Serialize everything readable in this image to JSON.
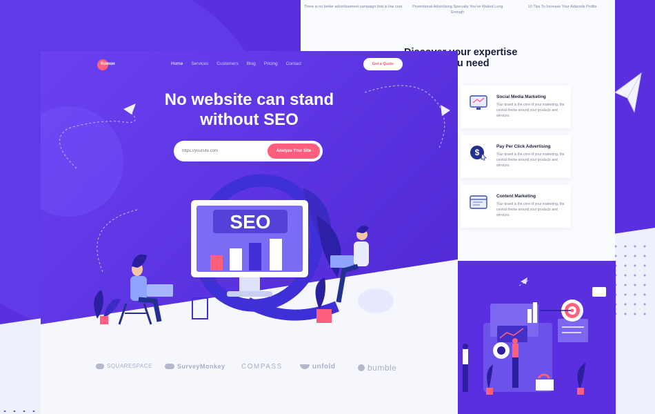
{
  "colors": {
    "brand_purple": "#5a2fe0",
    "accent_pink": "#ff5f7e",
    "light_bg": "#f6f7fd"
  },
  "nav": {
    "logo": "Romon",
    "links": [
      "Home",
      "Services",
      "Customers",
      "Blog",
      "Pricing",
      "Contact"
    ],
    "active": "Home",
    "cta": "Get a Quote"
  },
  "hero": {
    "title_line1": "No website can stand",
    "title_line2": "without SEO",
    "search_placeholder": "https://yoursite.com",
    "analyze_button": "Analyze Your Site",
    "illustration_text": "SEO"
  },
  "brands": [
    "SQUARESPACE",
    "SurveyMonkey",
    "COMPASS",
    "unfold",
    "bumble"
  ],
  "right_panel": {
    "top_texts": [
      "There is no better advertisement campaign that is low cost",
      "Promotional Advertising Specialty You've Waited Long Enough",
      "10 Tips To Increase Your Adwords Profits"
    ],
    "section_title_line1": "Discover your expertise",
    "section_title_line2": "you need",
    "services": [
      {
        "title": "Social Media Marketing",
        "desc": "Your brand is the core of your marketing, the central theme around your products and services.",
        "icon": "monitor-icon"
      },
      {
        "title": "Pay Per Click Advertising",
        "desc": "Your brand is the core of your marketing, the central theme around your products and services.",
        "icon": "dollar-cursor-icon"
      },
      {
        "title": "Content Marketing",
        "desc": "Your brand is the core of your marketing, the central theme around your products and services.",
        "icon": "browser-icon"
      }
    ]
  }
}
